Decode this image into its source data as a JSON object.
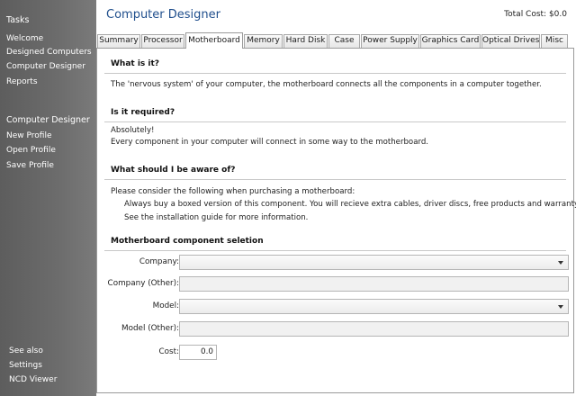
{
  "sidebar": {
    "tasks_header": "Tasks",
    "tasks": [
      "Welcome",
      "Designed Computers",
      "Computer Designer",
      "Reports"
    ],
    "designer_header": "Computer Designer",
    "designer_items": [
      "New Profile",
      "Open Profile",
      "Save Profile"
    ],
    "see_also_header": "See also",
    "see_also_items": [
      "Settings",
      "NCD Viewer"
    ]
  },
  "header": {
    "title": "Computer Designer",
    "total_cost": "Total Cost: $0.0"
  },
  "tabs": [
    "Summary",
    "Processor",
    "Motherboard",
    "Memory",
    "Hard Disk",
    "Case",
    "Power Supply",
    "Graphics Card",
    "Optical Drives",
    "Misc"
  ],
  "active_tab": "Motherboard",
  "content": {
    "q1": "What is it?",
    "a1": "The 'nervous system' of your computer, the motherboard connects all the components in a computer together.",
    "q2": "Is it required?",
    "a2_line1": "Absolutely!",
    "a2_line2": "Every component in your computer will connect in some way to the motherboard.",
    "q3": "What should I be aware of?",
    "a3_intro": "Please consider the following when purchasing a motherboard:",
    "a3_tip1": "Always buy a boxed version of this component. You will recieve extra cables, driver discs, free products and warranty.",
    "a3_tip2": "See the installation guide for more information.",
    "form_header": "Motherboard component seletion",
    "form": {
      "company_label": "Company:",
      "company_value": "",
      "company_other_label": "Company (Other):",
      "company_other_value": "",
      "model_label": "Model:",
      "model_value": "",
      "model_other_label": "Model (Other):",
      "model_other_value": "",
      "cost_label": "Cost:",
      "cost_value": "0.0"
    }
  }
}
